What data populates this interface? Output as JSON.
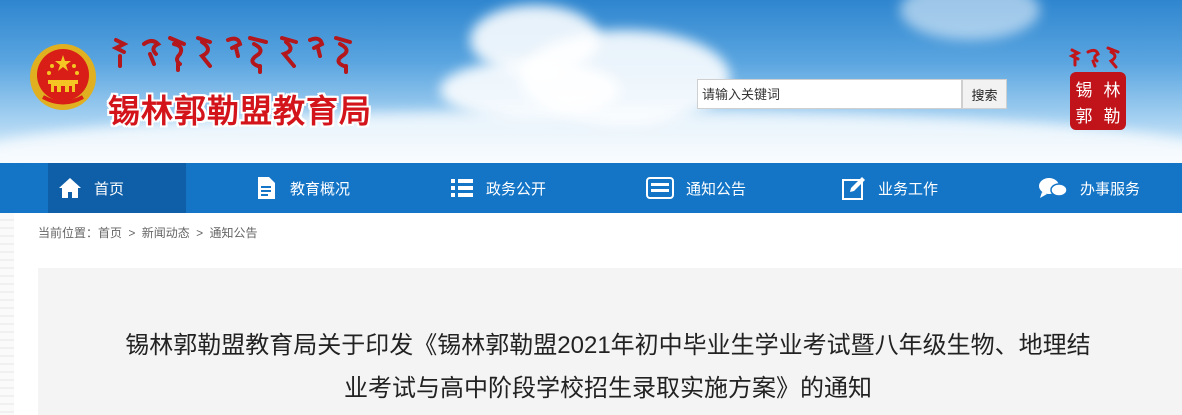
{
  "header": {
    "site_title": "锡林郭勒盟教育局",
    "search": {
      "placeholder": "请输入关键词",
      "button_label": "搜索"
    },
    "right_logo": {
      "chars": [
        "锡",
        "林",
        "郭",
        "勒"
      ]
    }
  },
  "nav": {
    "items": [
      {
        "label": "首页",
        "icon": "home-icon",
        "active": true
      },
      {
        "label": "教育概况",
        "icon": "document-icon"
      },
      {
        "label": "政务公开",
        "icon": "list-icon"
      },
      {
        "label": "通知公告",
        "icon": "notice-card-icon"
      },
      {
        "label": "业务工作",
        "icon": "edit-icon"
      },
      {
        "label": "办事服务",
        "icon": "chat-icon"
      }
    ]
  },
  "breadcrumb": {
    "prefix": "当前位置：",
    "items": [
      "首页",
      "新闻动态",
      "通知公告"
    ],
    "separator": ">"
  },
  "article": {
    "title_line1": "锡林郭勒盟教育局关于印发《锡林郭勒盟2021年初中毕业生学业考试暨八年级生物、地理结",
    "title_line2": "业考试与高中阶段学校招生录取实施方案》的通知"
  },
  "colors": {
    "nav_bg": "#1475c7",
    "nav_active": "#0f5fa8",
    "title_red": "#d3141b",
    "article_bg": "#f4f4f4"
  }
}
